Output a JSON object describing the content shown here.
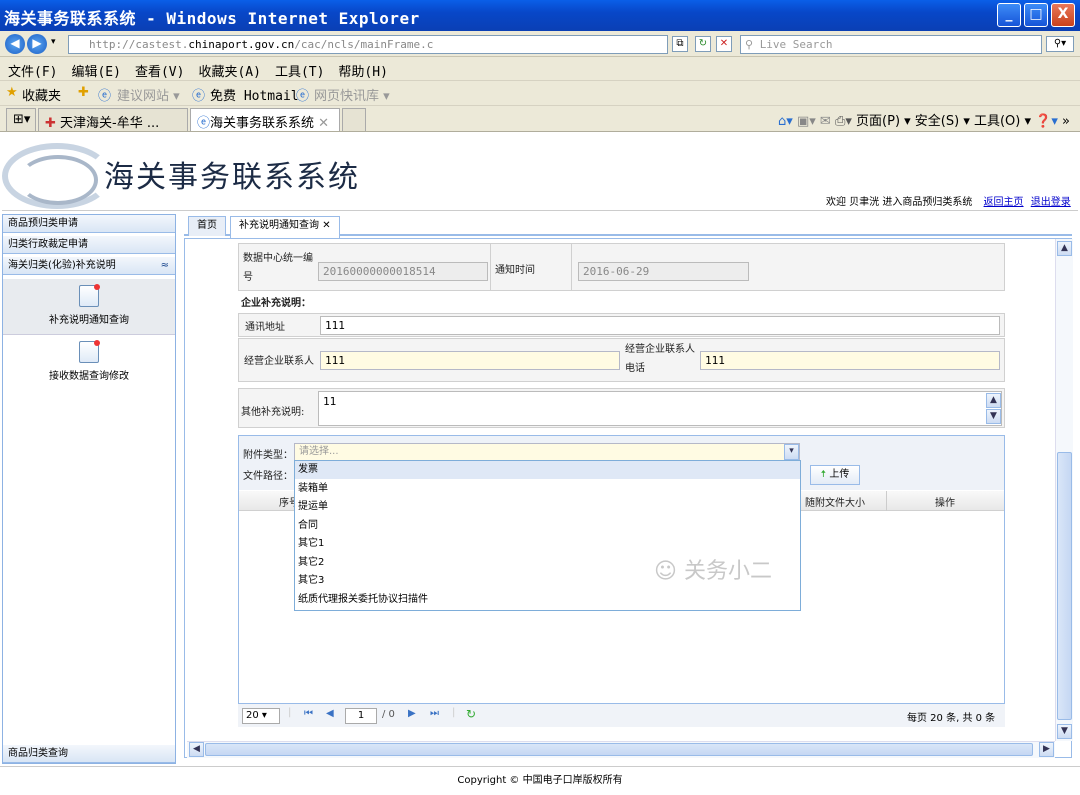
{
  "window": {
    "title": "海关事务联系系统 - Windows Internet Explorer",
    "controls": {
      "minimize": "_",
      "maximize": "□",
      "close": "X"
    }
  },
  "addressbar": {
    "url_prefix": "http://castest.",
    "url_domain": "chinaport.gov.cn",
    "url_suffix": "/cac/ncls/mainFrame.c",
    "search_placeholder": "Live Search"
  },
  "menubar": {
    "items": [
      "文件(F)",
      "编辑(E)",
      "查看(V)",
      "收藏夹(A)",
      "工具(T)",
      "帮助(H)"
    ]
  },
  "favbar": {
    "favorites": "收藏夹",
    "suggested": "建议网站 ▾",
    "hotmail": "免费 Hotmail",
    "webslice": "网页快讯库 ▾"
  },
  "tabs": {
    "tab1": "天津海关-牟华 ...",
    "tab2": "海关事务联系系统",
    "commands": "页面(P) ▾  安全(S) ▾  工具(O) ▾"
  },
  "banner": {
    "system_title": "海关事务联系系统",
    "welcome": "欢迎 贝聿洸 进入商品预归类系统",
    "back_home": "返回主页",
    "logout": "退出登录"
  },
  "leftnav": {
    "header1": "商品预归类申请",
    "header2": "归类行政裁定申请",
    "header3": "海关归类(化验)补充说明",
    "item1": "补充说明通知查询",
    "item2": "接收数据查询修改",
    "bottom": "商品归类查询"
  },
  "maintabs": {
    "home": "首页",
    "active": "补充说明通知查询"
  },
  "form": {
    "center_no_label": "数据中心统一编号",
    "center_no": "20160000000018514",
    "notify_time_label": "通知时间",
    "notify_time": "2016-06-29",
    "section_title": "企业补充说明：",
    "address_label": "通讯地址",
    "address": "111",
    "contact_label": "经营企业联系人",
    "contact": "111",
    "contact_phone_label": "经营企业联系人电话",
    "contact_phone": "111",
    "other_label": "其他补充说明:",
    "other": "11"
  },
  "attachments": {
    "type_label": "附件类型：",
    "type_placeholder": "请选择...",
    "path_label": "文件路径：",
    "upload_btn": "上传",
    "col_no": "序号",
    "col_size": "随附文件大小",
    "col_op": "操作",
    "options": [
      "发票",
      "装箱单",
      "提运单",
      "合同",
      "其它1",
      "其它2",
      "其它3",
      "纸质代理报关委托协议扫描件"
    ]
  },
  "pager": {
    "page_size": "20",
    "page": "1",
    "total_pages": "/ 0",
    "summary": "每页 20 条, 共 0 条"
  },
  "watermark": "关务小二",
  "footer": "Copyright © 中国电子口岸版权所有"
}
